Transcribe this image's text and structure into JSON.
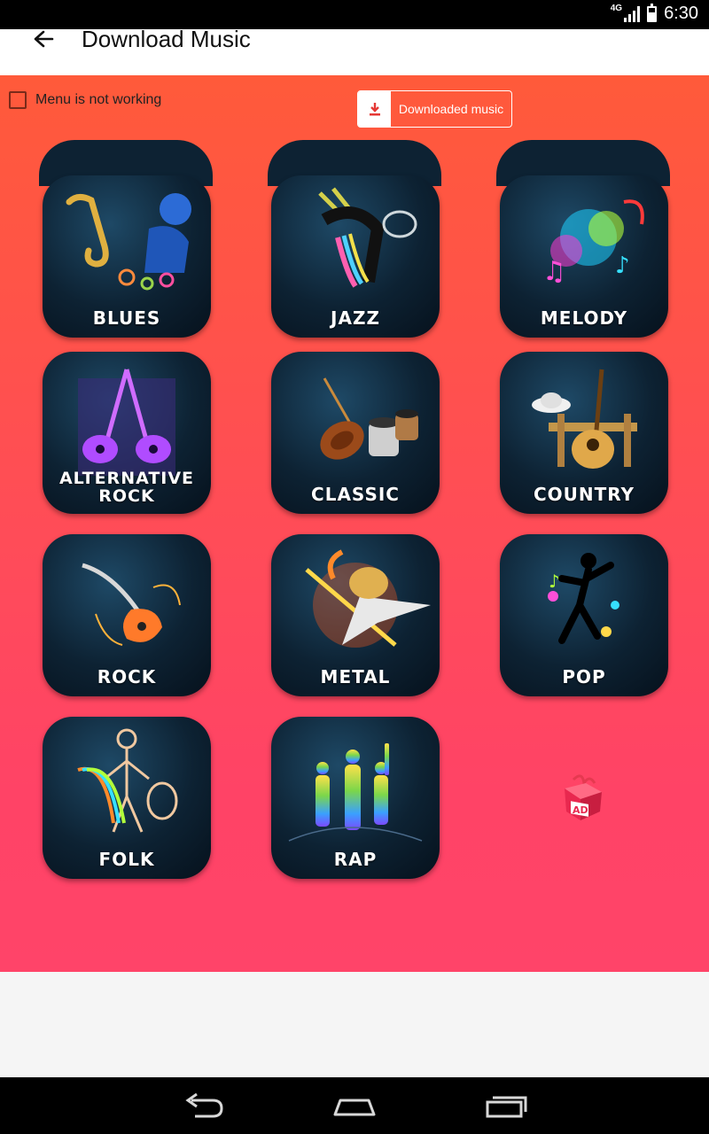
{
  "status_bar": {
    "network": "4G",
    "time": "6:30"
  },
  "app_bar": {
    "title": "Download Music"
  },
  "controls": {
    "checkbox_label": "Menu is not working",
    "downloaded_button_label": "Downloaded music"
  },
  "genres": [
    {
      "label": "BLUES",
      "icon": "saxophone-guitarist-icon"
    },
    {
      "label": "JAZZ",
      "icon": "trumpet-jazz-icon"
    },
    {
      "label": "MELODY",
      "icon": "colorful-music-notes-icon"
    },
    {
      "label_line1": "ALTERNATIVE",
      "label_line2": "ROCK",
      "icon": "crossed-guitars-icon"
    },
    {
      "label": "CLASSIC",
      "icon": "violin-drums-icon"
    },
    {
      "label": "COUNTRY",
      "icon": "acoustic-guitar-hat-icon"
    },
    {
      "label": "ROCK",
      "icon": "electric-guitar-icon"
    },
    {
      "label": "METAL",
      "icon": "flaming-guitar-icon"
    },
    {
      "label": "POP",
      "icon": "dancing-silhouette-icon"
    },
    {
      "label": "FOLK",
      "icon": "folk-musician-icon"
    },
    {
      "label": "RAP",
      "icon": "rap-silhouettes-icon"
    }
  ],
  "ad": {
    "text": "AD",
    "icon": "gift-ad-icon"
  },
  "colors": {
    "accent_top": "#ff5a3a",
    "accent_bottom": "#ff4469",
    "tile_bg": "#0d2233"
  }
}
